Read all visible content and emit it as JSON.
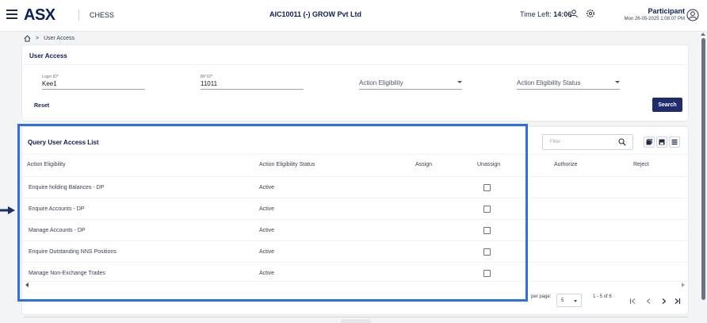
{
  "header": {
    "logo": "ASX",
    "app_name": "CHESS",
    "company": "AIC10011 (-) GROW Pvt Ltd",
    "time_left_label": "Time Left:",
    "time_left_value": "14:06",
    "role": "Participant",
    "datetime": "Mon 26-05-2025 1:08:07 PM"
  },
  "breadcrumb": {
    "current": "User Access",
    "separator": ">"
  },
  "user_access": {
    "title": "User Access",
    "login_id": {
      "label": "Login ID",
      "required": "*",
      "value": "Kee1"
    },
    "bp_id": {
      "label": "BP ID",
      "required": "*",
      "value": "11011"
    },
    "action_eligibility": {
      "placeholder": "Action Eligibility"
    },
    "action_eligibility_status": {
      "placeholder": "Action Eligibility Status"
    },
    "reset_label": "Reset",
    "search_label": "Search"
  },
  "list": {
    "title": "Query User Access List",
    "filter_placeholder": "Filter",
    "columns": {
      "action_eligibility": "Action Eligibility",
      "status": "Action Eligibility Status",
      "assign": "Assign",
      "unassign": "Unassign",
      "authorize": "Authorize",
      "reject": "Reject"
    },
    "rows": [
      {
        "action": "Enquire holding Balances - DP",
        "status": "Active",
        "unassign_checked": false
      },
      {
        "action": "Enquire Accounts - DP",
        "status": "Active",
        "unassign_checked": false
      },
      {
        "action": "Manage Accounts - DP",
        "status": "Active",
        "unassign_checked": false
      },
      {
        "action": "Enquire Outstanding NNS Positions",
        "status": "Active",
        "unassign_checked": false
      },
      {
        "action": "Manage Non-Exchange Trades",
        "status": "Active",
        "unassign_checked": false
      }
    ],
    "pagination": {
      "rows_per_page_label": "per page:",
      "rows_per_page": "5",
      "range": "1 - 5 of 6"
    }
  },
  "icons": {
    "menu": "hamburger-icon",
    "user": "user-icon",
    "settings": "gear-icon",
    "avatar": "account-circle-icon",
    "home": "home-icon",
    "search": "magnifier-icon"
  },
  "colors": {
    "brand": "#0b1f55",
    "primary_button": "#1e2c6b",
    "highlight": "#2f6fe0",
    "required": "#dc2626"
  }
}
